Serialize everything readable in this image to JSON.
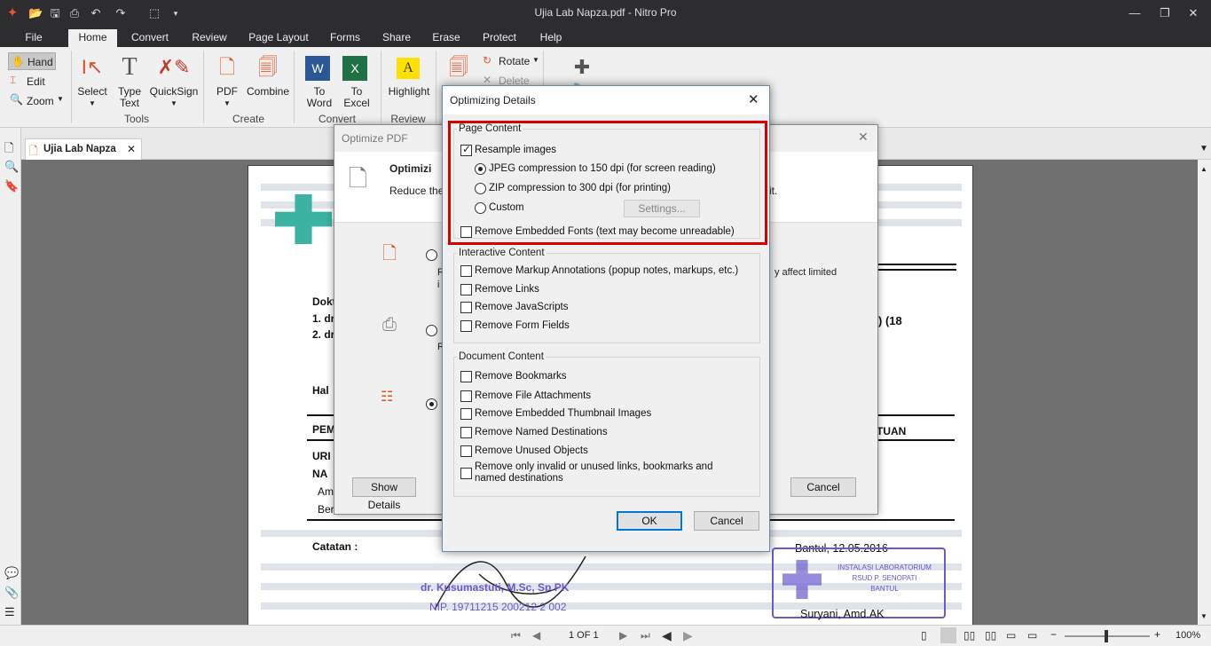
{
  "titlebar": {
    "title": "Ujia Lab Napza.pdf - Nitro Pro"
  },
  "menu": {
    "file": "File",
    "tabs": [
      "Home",
      "Convert",
      "Review",
      "Page Layout",
      "Forms",
      "Share",
      "Erase",
      "Protect",
      "Help"
    ]
  },
  "ribbon": {
    "hand": "Hand",
    "edit": "Edit",
    "zoom": "Zoom",
    "select": "Select",
    "type_text_1": "Type",
    "type_text_2": "Text",
    "quicksign": "QuickSign",
    "tools_group": "Tools",
    "pdf": "PDF",
    "combine": "Combine",
    "create_group": "Create",
    "to_word_1": "To",
    "to_word_2": "Word",
    "to_excel_1": "To",
    "to_excel_2": "Excel",
    "convert_group": "Convert",
    "highlight": "Highlight",
    "review_group": "Review",
    "rotate": "Rotate",
    "delete": "Delete"
  },
  "doc": {
    "tab_title": "Ujia Lab Napza"
  },
  "page_text": {
    "dok": "Dokt",
    "l1": "1. dr",
    "l2": "2. dr",
    "hal": "Hal",
    "pem": "PEM",
    "uri": "URI",
    "na": "NA",
    "am": "Am",
    "be": "Ber",
    "tuan": "TUAN",
    "paren": ") (18",
    "catatan": "Catatan  :",
    "date": "Bantul, 12.05.2016",
    "doctor": "dr. Kusumastuti, M.Sc, Sp.PK",
    "nip": "NIP. 19711215 200212 2 002",
    "signer": "Suryani, Amd.AK",
    "stamp1": "INSTALASI LABORATORIUM",
    "stamp2": "RSUD P. SENOPATI",
    "stamp3": "BANTUL"
  },
  "optimize_dialog": {
    "title": "Optimize PDF",
    "heading": "Optimizi",
    "desc": "Reduce the",
    "desc_end": "it.",
    "affect": "y affect limited",
    "affect2": "i",
    "opt_r1": "R",
    "opt_r2": "R",
    "show_details": "Show Details",
    "cancel": "Cancel"
  },
  "details_dialog": {
    "title": "Optimizing Details",
    "page_content": {
      "title": "Page Content",
      "resample": "Resample images",
      "jpeg": "JPEG compression to 150 dpi (for screen reading)",
      "zip": "ZIP compression to 300 dpi (for printing)",
      "custom": "Custom",
      "settings": "Settings...",
      "remove_fonts": "Remove Embedded Fonts (text may become unreadable)"
    },
    "interactive_content": {
      "title": "Interactive Content",
      "items": [
        "Remove Markup Annotations (popup notes, markups, etc.)",
        "Remove Links",
        "Remove JavaScripts",
        "Remove Form Fields"
      ]
    },
    "document_content": {
      "title": "Document Content",
      "items": [
        "Remove Bookmarks",
        "Remove File Attachments",
        "Remove Embedded Thumbnail Images",
        "Remove Named Destinations",
        "Remove Unused Objects"
      ],
      "last_1": "Remove only invalid or unused links, bookmarks and",
      "last_2": "named destinations"
    },
    "ok": "OK",
    "cancel": "Cancel"
  },
  "status": {
    "page": "1 OF 1",
    "zoom": "100%"
  }
}
